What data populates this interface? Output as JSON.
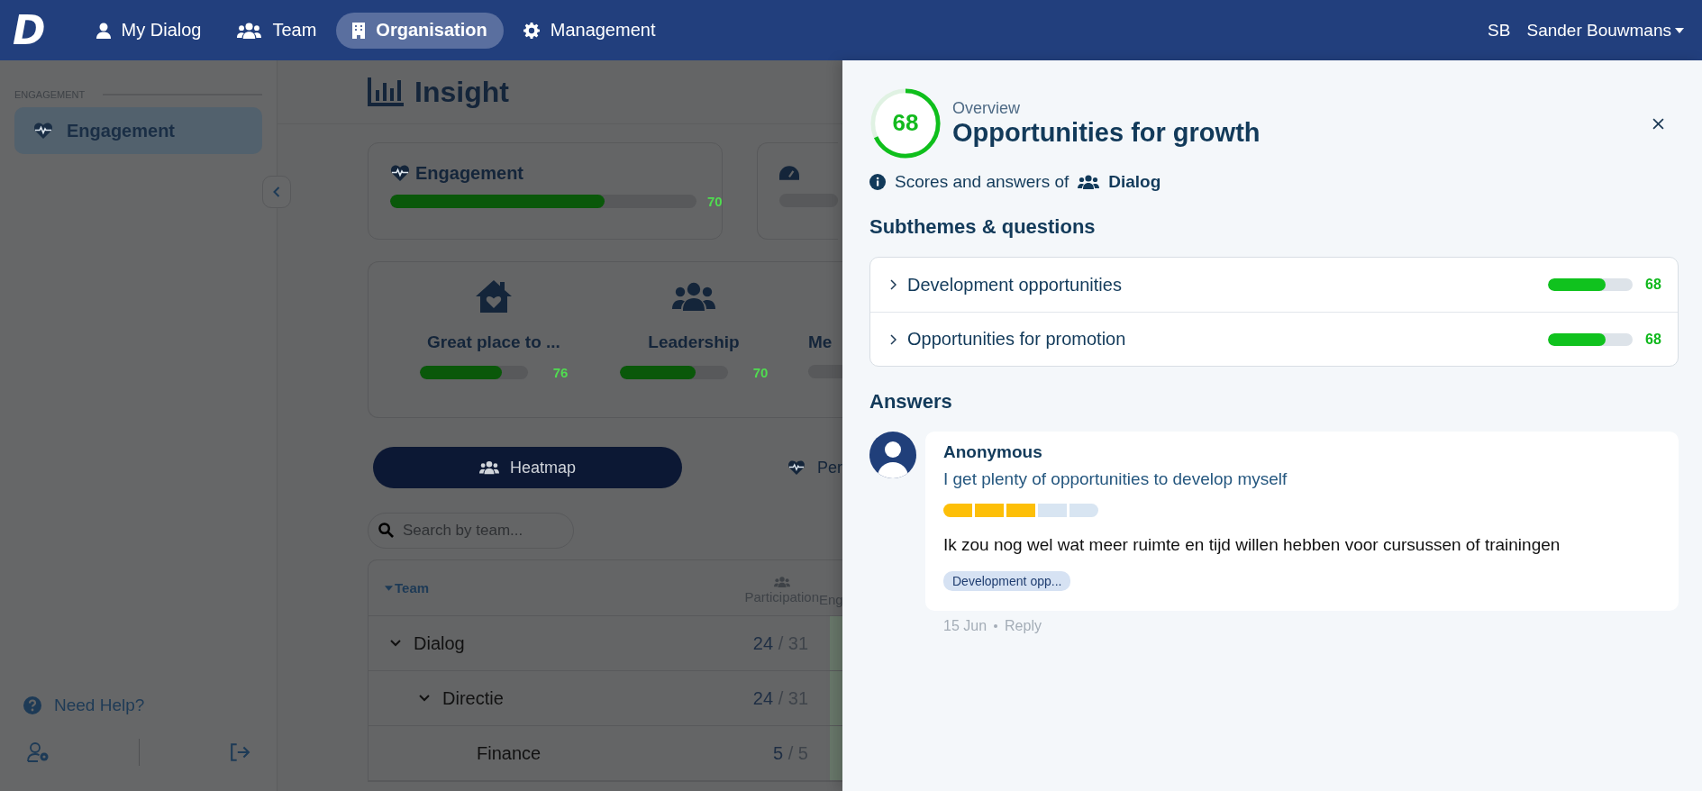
{
  "nav": {
    "logo": "D",
    "items": [
      {
        "label": "My Dialog",
        "selected": false
      },
      {
        "label": "Team",
        "selected": false
      },
      {
        "label": "Organisation",
        "selected": true
      },
      {
        "label": "Management",
        "selected": false
      }
    ],
    "user": {
      "initials": "SB",
      "name": "Sander Bouwmans"
    }
  },
  "sidebar": {
    "section": "ENGAGEMENT",
    "items": [
      {
        "label": "Engagement",
        "selected": true
      }
    ],
    "help": "Need Help?"
  },
  "main": {
    "title": "Insight",
    "cards": [
      {
        "label": "Engagement",
        "level": 0.7,
        "score": "70"
      },
      {
        "kind": "partial"
      }
    ],
    "categories": [
      {
        "label": "Great place to ...",
        "level": 0.76,
        "score": "76"
      },
      {
        "label": "Leadership",
        "level": 0.7,
        "score": "70"
      },
      {
        "label": "Me"
      }
    ],
    "views": [
      {
        "label": "Heatmap",
        "selected": true
      },
      {
        "label": "Per",
        "selected": false
      }
    ],
    "search": {
      "placeholder": "Search by team..."
    },
    "table": {
      "columns": [
        "Team",
        "Participation",
        "Eng"
      ],
      "rows": [
        {
          "name": "Dialog",
          "expanded": true,
          "count": "24",
          "separator": "/",
          "total": "31",
          "children": [
            {
              "name": "Directie",
              "expanded": true,
              "count": "24",
              "separator": "/",
              "total": "31",
              "children": [
                {
                  "name": "Finance",
                  "count": "5",
                  "separator": "/",
                  "total": "5"
                }
              ]
            }
          ]
        }
      ]
    }
  },
  "panel": {
    "score": "68",
    "level": 0.68,
    "kicker": "Overview",
    "title": "Opportunities for growth",
    "info": "Scores and answers of",
    "team": "Dialog",
    "subthemes_title": "Subthemes & questions",
    "subthemes": [
      {
        "label": "Development opportunities",
        "expanded": false,
        "level": 0.68,
        "score": "68"
      },
      {
        "label": "Opportunities for promotion",
        "expanded": false,
        "level": 0.68,
        "score": "68"
      }
    ],
    "answers_title": "Answers",
    "answers": [
      {
        "author": "Anonymous",
        "question": "I get plenty of opportunities to develop myself",
        "stars": 3,
        "comment": "Ik zou nog wel wat meer ruimte en tijd willen hebben voor cursussen of trainingen",
        "tag": "Development opp...",
        "date": "15 Jun",
        "action": "Reply"
      }
    ]
  }
}
